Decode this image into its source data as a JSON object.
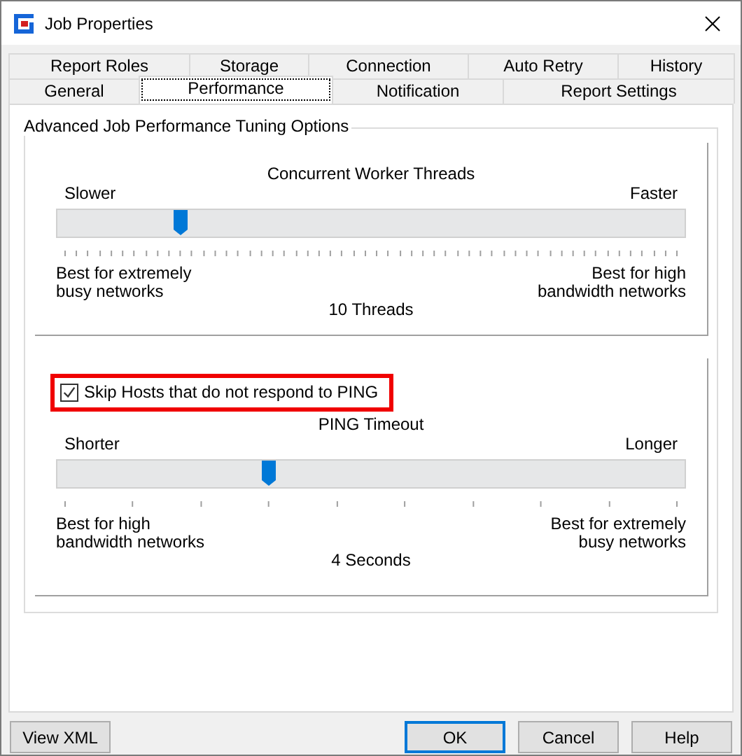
{
  "window": {
    "title": "Job Properties"
  },
  "tab_rows": [
    {
      "tabs": [
        {
          "label": "Report Roles",
          "selected": false
        },
        {
          "label": "Storage",
          "selected": false
        },
        {
          "label": "Connection",
          "selected": false
        },
        {
          "label": "Auto Retry",
          "selected": false
        },
        {
          "label": "History",
          "selected": false
        }
      ]
    },
    {
      "tabs": [
        {
          "label": "General",
          "selected": false
        },
        {
          "label": "Performance",
          "selected": true
        },
        {
          "label": "Notification",
          "selected": false
        },
        {
          "label": "Report Settings",
          "selected": false
        }
      ]
    }
  ],
  "group": {
    "title": "Advanced Job Performance Tuning Options"
  },
  "sections": [
    {
      "title": "Concurrent Worker Threads",
      "min_label": "Slower",
      "max_label": "Faster",
      "level": 0.19,
      "left_note": [
        "Best for extremely",
        "busy networks"
      ],
      "right_note": [
        "Best for high",
        "bandwidth networks"
      ],
      "reading": "10 Threads"
    },
    {
      "checkbox": {
        "label": "Skip Hosts that do not respond to PING",
        "checked": true,
        "highlighted": true
      },
      "title": "PING Timeout",
      "min_label": "Shorter",
      "max_label": "Longer",
      "level": 0.333,
      "left_note": [
        "Best for high",
        "bandwidth networks"
      ],
      "right_note": [
        "Best for extremely",
        "busy networks"
      ],
      "reading": "4 Seconds"
    }
  ],
  "footer": {
    "left": [
      {
        "label": "View XML",
        "default": false
      }
    ],
    "right": [
      {
        "label": "OK",
        "default": true
      },
      {
        "label": "Cancel",
        "default": false
      },
      {
        "label": "Help",
        "default": false
      }
    ]
  }
}
